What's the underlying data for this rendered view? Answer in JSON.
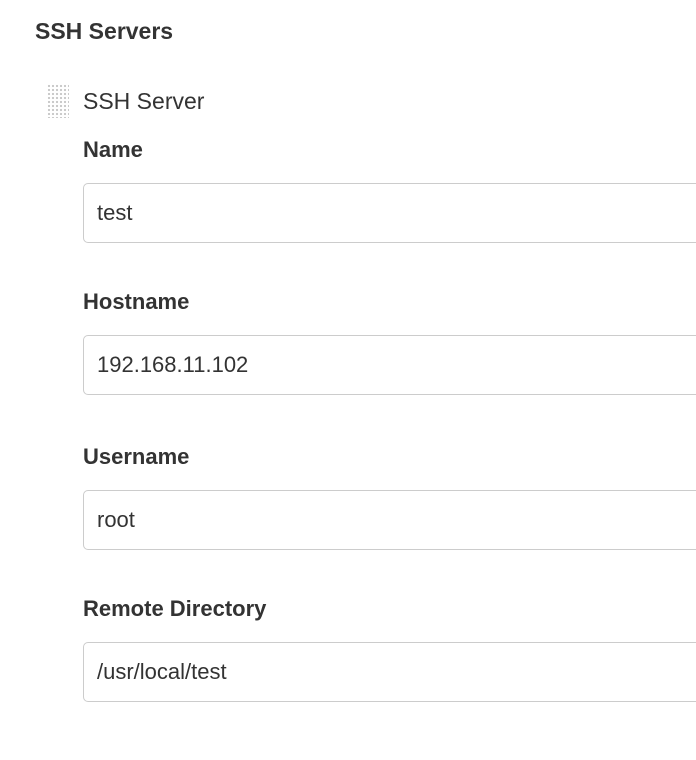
{
  "section": {
    "title": "SSH Servers"
  },
  "server": {
    "title": "SSH Server",
    "drag_icon": "drag-handle-icon",
    "fields": {
      "name": {
        "label": "Name",
        "value": "test"
      },
      "hostname": {
        "label": "Hostname",
        "value": "192.168.11.102"
      },
      "username": {
        "label": "Username",
        "value": "root"
      },
      "remote_directory": {
        "label": "Remote Directory",
        "value": "/usr/local/test"
      }
    }
  }
}
